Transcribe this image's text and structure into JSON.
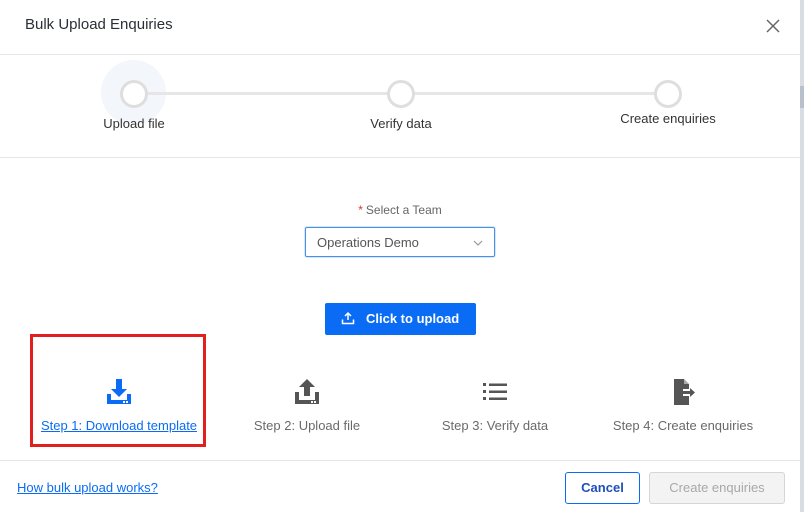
{
  "dialog": {
    "title": "Bulk Upload Enquiries",
    "close_icon": "close-icon"
  },
  "stepper": {
    "active_index": 0,
    "steps": [
      {
        "label": "Upload file"
      },
      {
        "label": "Verify data"
      },
      {
        "label": "Create enquiries"
      }
    ]
  },
  "team_select": {
    "required_mark": "*",
    "label": "Select a Team",
    "value": "Operations Demo",
    "icon": "chevron-down-icon"
  },
  "upload_button": {
    "label": "Click to upload",
    "icon": "upload-icon"
  },
  "guide_steps": [
    {
      "label": "Step 1: Download template",
      "icon": "download-icon",
      "is_link": true
    },
    {
      "label": "Step 2: Upload file",
      "icon": "upload-tray-icon",
      "is_link": false
    },
    {
      "label": "Step 3: Verify data",
      "icon": "list-icon",
      "is_link": false
    },
    {
      "label": "Step 4: Create enquiries",
      "icon": "file-export-icon",
      "is_link": false
    }
  ],
  "footer": {
    "help_link": "How bulk upload works?",
    "cancel_label": "Cancel",
    "create_label": "Create enquiries",
    "create_disabled": true
  },
  "colors": {
    "primary": "#0a6cf5",
    "highlight_border": "#e0201c",
    "required": "#e0332d",
    "disabled_bg": "#f3f3f3"
  }
}
